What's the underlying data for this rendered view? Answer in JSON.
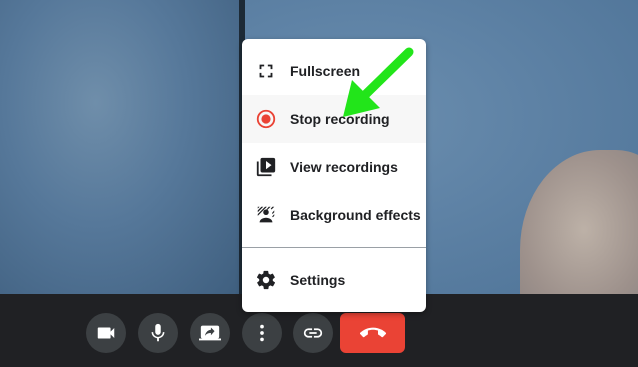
{
  "menu": {
    "items": [
      {
        "label": "Fullscreen",
        "icon": "fullscreen-icon"
      },
      {
        "label": "Stop recording",
        "icon": "record-icon"
      },
      {
        "label": "View recordings",
        "icon": "video-library-icon"
      },
      {
        "label": "Background effects",
        "icon": "background-effects-icon"
      },
      {
        "label": "Settings",
        "icon": "gear-icon"
      }
    ]
  },
  "toolbar": {
    "buttons": [
      "camera-icon",
      "microphone-icon",
      "share-screen-icon",
      "more-vert-icon",
      "link-icon"
    ],
    "end_call_icon": "hang-up-icon"
  },
  "colors": {
    "record_red": "#ea4335",
    "end_call_red": "#ea4335",
    "arrow_green": "#22e51a",
    "toolbar_bg": "#202124"
  }
}
